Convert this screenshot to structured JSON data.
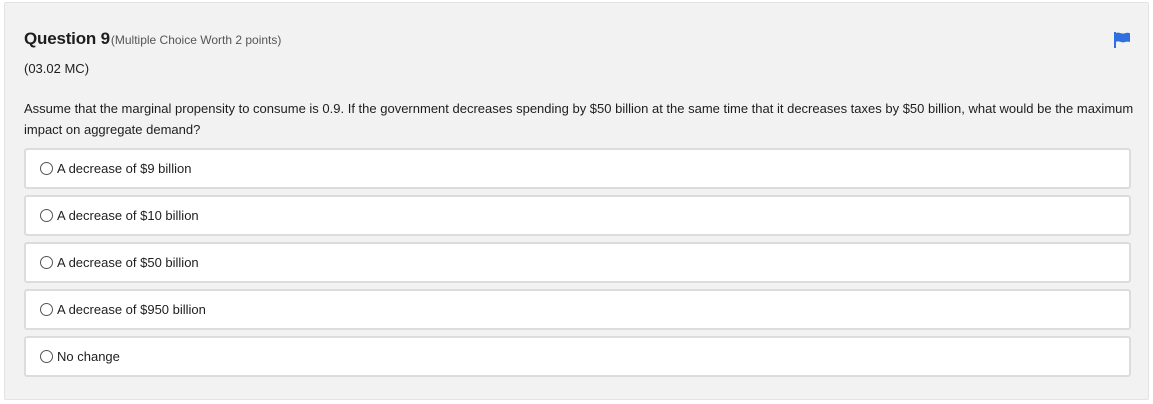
{
  "question": {
    "title": "Question 9",
    "meta": "(Multiple Choice Worth 2 points)",
    "code": "(03.02 MC)",
    "stem": "Assume that the marginal propensity to consume is 0.9. If the government decreases spending by $50 billion at the same time that it decreases taxes by $50 billion, what would be the maximum impact on aggregate demand?",
    "flag_icon": "flag-icon",
    "flag_color": "#2f6fe0"
  },
  "choices": [
    {
      "label": "A decrease of $9 billion",
      "selected": false
    },
    {
      "label": "A decrease of $10 billion",
      "selected": false
    },
    {
      "label": "A decrease of $50 billion",
      "selected": false
    },
    {
      "label": "A decrease of $950 billion",
      "selected": false
    },
    {
      "label": "No change",
      "selected": false
    }
  ]
}
